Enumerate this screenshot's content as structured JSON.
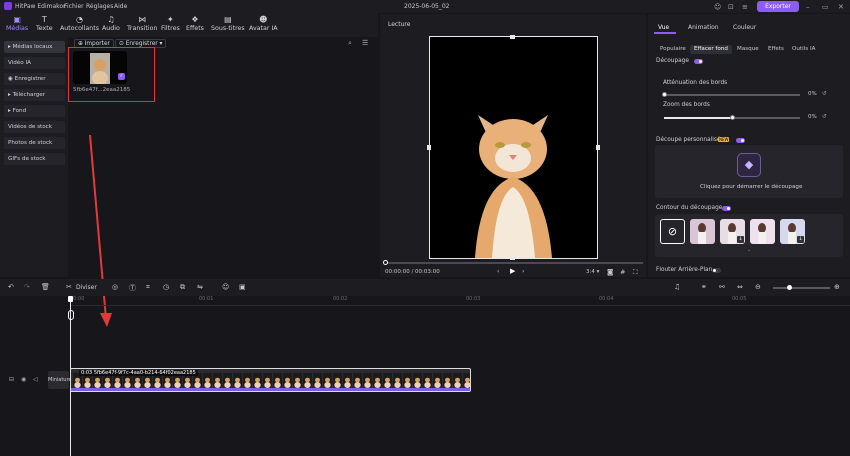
{
  "app": {
    "name": "HitPaw Edimakor",
    "menus": [
      "Fichier",
      "Réglages",
      "Aide"
    ],
    "doc_title": "2025-06-05_02",
    "export_label": "Exporter"
  },
  "toolbar": [
    {
      "label": "Médias",
      "icon": "media-icon",
      "active": true
    },
    {
      "label": "Texte",
      "icon": "text-icon"
    },
    {
      "label": "Autocollants",
      "icon": "sticker-icon"
    },
    {
      "label": "Audio",
      "icon": "audio-icon"
    },
    {
      "label": "Transition",
      "icon": "transition-icon"
    },
    {
      "label": "Filtres",
      "icon": "filter-icon"
    },
    {
      "label": "Effets",
      "icon": "effects-icon"
    },
    {
      "label": "Sous-titres",
      "icon": "subtitle-icon"
    },
    {
      "label": "Avatar IA",
      "icon": "avatar-icon"
    }
  ],
  "sidebar": [
    "Médias locaux",
    "Vidéo IA",
    "Enregistrer",
    "Télécharger",
    "Fond",
    "Vidéos de stock",
    "Photos de stock",
    "GIFs de stock"
  ],
  "media": {
    "import_label": "Importer",
    "record_label": "Enregistrer",
    "item_name": "5fb6e47f...2eaa2185"
  },
  "preview": {
    "title": "Lecture",
    "time": "00:00:00 / 00:03:00",
    "ratio": "3:4"
  },
  "props": {
    "tabs": [
      "Vue",
      "Animation",
      "Couleur"
    ],
    "subtabs": [
      "Populaire",
      "Effacer fond",
      "Masque",
      "Effets",
      "Outils IA"
    ],
    "cutout_label": "Découpage",
    "edge_attenuation": "Atténuation des bords",
    "edge_zoom": "Zoom des bords",
    "edge_attenuation_value": "0%",
    "edge_zoom_value": "0%",
    "custom_cutout": "Découpe personnalisée",
    "new_badge": "NEW",
    "click_cutout": "Cliquez pour démarrer le découpage",
    "contour_label": "Contour du découpage",
    "blur_bg": "Flouter Arrière-Plan"
  },
  "timeline": {
    "split_label": "Diviser",
    "ruler": [
      "00:00",
      "00:01",
      "00:02",
      "00:03",
      "00:04",
      "00:05"
    ],
    "clip_label": "0:03 5fb6e47f-9f7c-4aa0-b214-64f02eaa2185",
    "track_label": "Miniature"
  },
  "colors": {
    "accent": "#8b5cf6",
    "highlight": "#d93636"
  }
}
